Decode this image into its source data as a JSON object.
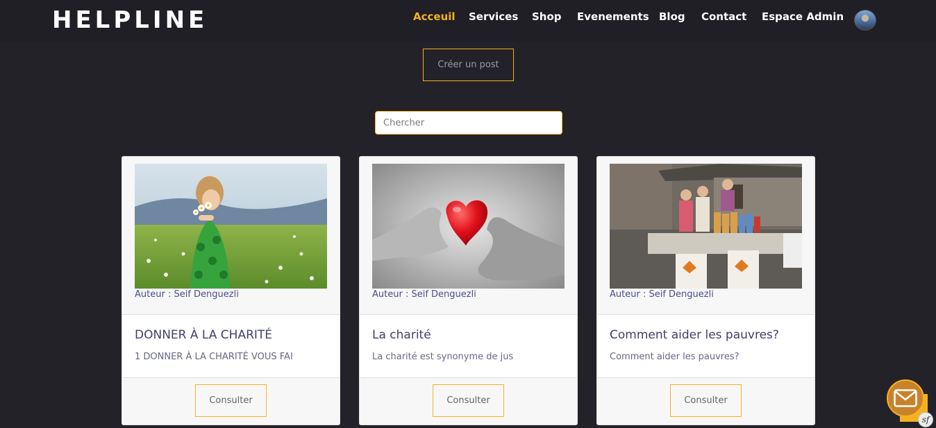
{
  "brand": {
    "name": "HELPLINE"
  },
  "nav": {
    "items": [
      {
        "label": "Acceuil",
        "active": true
      },
      {
        "label": "Services"
      },
      {
        "label": "Shop"
      },
      {
        "label": "Evenements"
      },
      {
        "label": "Blog"
      },
      {
        "label": "Contact"
      },
      {
        "label": "Espace Admin"
      }
    ]
  },
  "actions": {
    "create_post_label": "Créer un post"
  },
  "search": {
    "placeholder": "Chercher",
    "value": ""
  },
  "posts": [
    {
      "image": "child-with-daisies-photo",
      "author": "Auteur : Seif Denguezli",
      "title": "DONNER À LA CHARITÉ",
      "excerpt": "1 DONNER À LA CHARITÉ VOUS FAI",
      "button": "Consulter"
    },
    {
      "image": "hands-with-red-heart-photo",
      "author": "Auteur : Seif Denguezli",
      "title": "La charité",
      "excerpt": "La charité est synonyme de jus",
      "button": "Consulter"
    },
    {
      "image": "charity-food-stand-photo",
      "author": "Auteur : Seif Denguezli",
      "title": "Comment aider les pauvres?",
      "excerpt": "Comment aider les pauvres?",
      "button": "Consulter"
    }
  ],
  "widgets": {
    "chat_icon": "envelope-icon",
    "debug_badge": "sf"
  },
  "colors": {
    "accent": "#f4b223",
    "background": "#232228",
    "navbar": "#1f1f25"
  }
}
